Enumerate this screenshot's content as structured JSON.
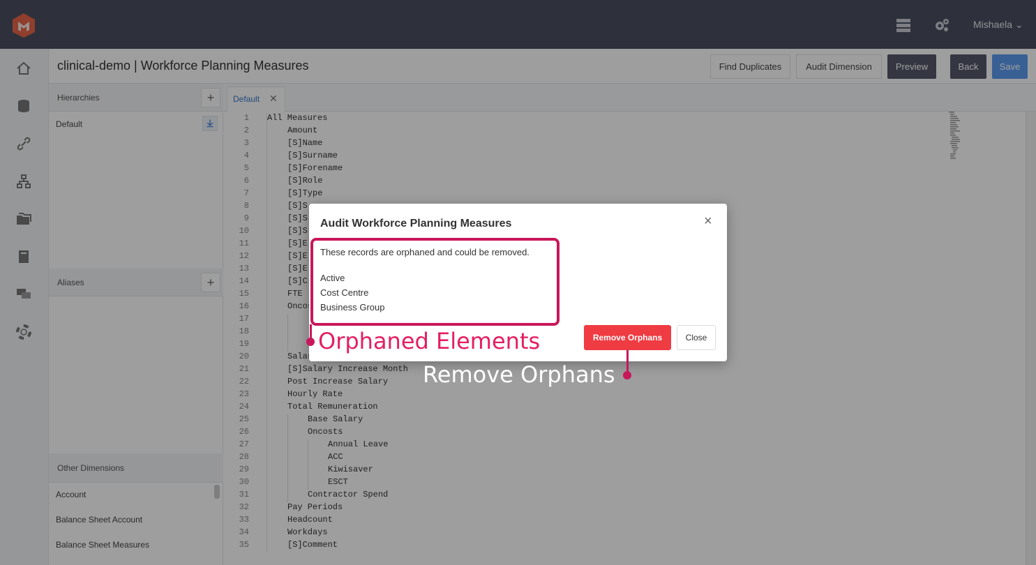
{
  "user": {
    "name": "Mishaela ⌄"
  },
  "header": {
    "title": "clinical-demo | Workforce Planning Measures",
    "buttons": {
      "find_duplicates": "Find Duplicates",
      "audit_dimension": "Audit Dimension",
      "preview": "Preview",
      "back": "Back",
      "save": "Save"
    }
  },
  "left_panel": {
    "hierarchies_label": "Hierarchies",
    "hierarchy_items": [
      "Default"
    ],
    "aliases_label": "Aliases",
    "other_dimensions_label": "Other Dimensions",
    "other_dimensions": [
      "Account",
      "Balance Sheet Account",
      "Balance Sheet Measures"
    ]
  },
  "editor": {
    "tab_label": "Default",
    "tab_close": "✕",
    "lines": [
      {
        "n": "1",
        "indent": 0,
        "text": "All Measures"
      },
      {
        "n": "2",
        "indent": 1,
        "text": "Amount"
      },
      {
        "n": "3",
        "indent": 1,
        "text": "[S]Name"
      },
      {
        "n": "4",
        "indent": 1,
        "text": "[S]Surname"
      },
      {
        "n": "5",
        "indent": 1,
        "text": "[S]Forename"
      },
      {
        "n": "6",
        "indent": 1,
        "text": "[S]Role"
      },
      {
        "n": "7",
        "indent": 1,
        "text": "[S]Type"
      },
      {
        "n": "8",
        "indent": 1,
        "text": "[S]S"
      },
      {
        "n": "9",
        "indent": 1,
        "text": "[S]S"
      },
      {
        "n": "10",
        "indent": 1,
        "text": "[S]S"
      },
      {
        "n": "11",
        "indent": 1,
        "text": "[S]E"
      },
      {
        "n": "12",
        "indent": 1,
        "text": "[S]E"
      },
      {
        "n": "13",
        "indent": 1,
        "text": "[S]E"
      },
      {
        "n": "14",
        "indent": 1,
        "text": "[S]C"
      },
      {
        "n": "15",
        "indent": 1,
        "text": "FTE"
      },
      {
        "n": "16",
        "indent": 1,
        "text": "Oncos"
      },
      {
        "n": "17",
        "indent": 2,
        "text": ""
      },
      {
        "n": "18",
        "indent": 2,
        "text": ""
      },
      {
        "n": "19",
        "indent": 2,
        "text": ""
      },
      {
        "n": "20",
        "indent": 1,
        "text": "Salar"
      },
      {
        "n": "21",
        "indent": 1,
        "text": "[S]Salary Increase Month"
      },
      {
        "n": "22",
        "indent": 1,
        "text": "Post Increase Salary"
      },
      {
        "n": "23",
        "indent": 1,
        "text": "Hourly Rate"
      },
      {
        "n": "24",
        "indent": 1,
        "text": "Total Remuneration"
      },
      {
        "n": "25",
        "indent": 2,
        "text": "Base Salary"
      },
      {
        "n": "26",
        "indent": 2,
        "text": "Oncosts"
      },
      {
        "n": "27",
        "indent": 3,
        "text": "Annual Leave"
      },
      {
        "n": "28",
        "indent": 3,
        "text": "ACC"
      },
      {
        "n": "29",
        "indent": 3,
        "text": "Kiwisaver"
      },
      {
        "n": "30",
        "indent": 3,
        "text": "ESCT"
      },
      {
        "n": "31",
        "indent": 2,
        "text": "Contractor Spend"
      },
      {
        "n": "32",
        "indent": 1,
        "text": "Pay Periods"
      },
      {
        "n": "33",
        "indent": 1,
        "text": "Headcount"
      },
      {
        "n": "34",
        "indent": 1,
        "text": "Workdays"
      },
      {
        "n": "35",
        "indent": 1,
        "text": "[S]Comment"
      }
    ]
  },
  "modal": {
    "title": "Audit Workforce Planning Measures",
    "close_icon": "×",
    "message": "These records are orphaned and could be removed.",
    "orphans": [
      "Active",
      "Cost Centre",
      "Business Group"
    ],
    "remove_button": "Remove Orphans",
    "close_button": "Close"
  },
  "annotations": {
    "orphaned_label": "Orphaned Elements",
    "remove_label": "Remove Orphans",
    "color": "#c8175b"
  }
}
